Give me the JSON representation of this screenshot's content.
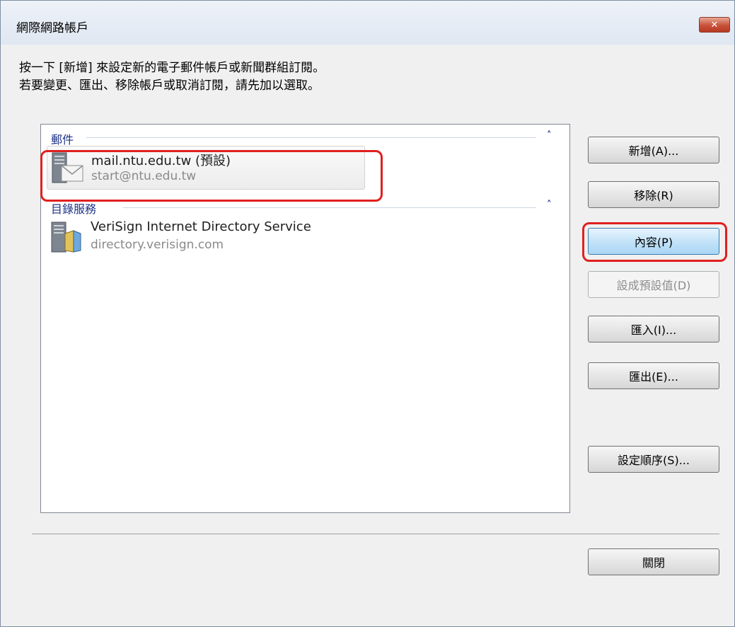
{
  "window": {
    "title": "網際網路帳戶",
    "close_glyph": "✕"
  },
  "instructions": {
    "line1": "按一下 [新增] 來設定新的電子郵件帳戶或新聞群組訂閱。",
    "line2": "若要變更、匯出、移除帳戶或取消訂閱，請先加以選取。"
  },
  "groups": {
    "mail": {
      "header": "郵件",
      "collapse_glyph": "˄",
      "account": {
        "name": "mail.ntu.edu.tw (預設)",
        "address": "start@ntu.edu.tw",
        "icon": "mail-server-icon"
      }
    },
    "directory": {
      "header": "目錄服務",
      "collapse_glyph": "˄",
      "account": {
        "name": "VeriSign Internet Directory Service",
        "address": "directory.verisign.com",
        "icon": "directory-server-icon"
      }
    }
  },
  "buttons": {
    "add": "新增(A)...",
    "remove": "移除(R)",
    "properties": "內容(P)",
    "set_default": "設成預設值(D)",
    "import": "匯入(I)...",
    "export": "匯出(E)...",
    "set_order": "設定順序(S)...",
    "close": "關閉"
  },
  "colors": {
    "highlight": "#e02020",
    "group_header": "#1e3287"
  }
}
